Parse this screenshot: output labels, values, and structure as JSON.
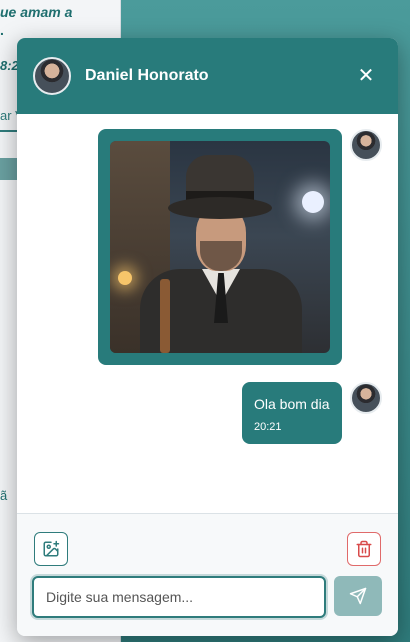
{
  "background": {
    "fragment_line1": "ue amam a",
    "fragment_line2": ".",
    "fragment_time": "8:2",
    "fragment_link": "ar V",
    "fragment_bottom": "ã"
  },
  "chat": {
    "contact_name": "Daniel Honorato",
    "close_label": "✕",
    "messages": [
      {
        "type": "image",
        "sender": "Daniel Honorato"
      },
      {
        "type": "text",
        "text": "Ola bom dia",
        "time": "20:21"
      }
    ],
    "input_placeholder": "Digite sua mensagem...",
    "input_value": ""
  },
  "colors": {
    "accent": "#287b7b",
    "danger": "#e06a6a",
    "send_disabled": "#8fb9b9"
  },
  "icons": {
    "add_image": "image-plus-icon",
    "delete": "trash-icon",
    "send": "send-icon",
    "close": "close-icon"
  }
}
